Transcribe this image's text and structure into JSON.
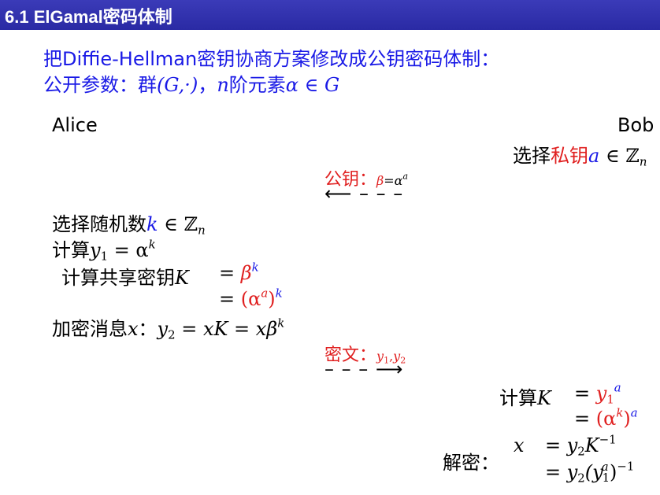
{
  "title": "6.1 ElGamal密码体制",
  "intro": {
    "line1": "把Diffie-Hellman密钥协商方案修改成公钥密码体制：",
    "line2_prefix": "公开参数：群",
    "line2_group": "(G,·)",
    "line2_sep": "，",
    "line2_n": "n",
    "line2_rest": "阶元素",
    "line2_expr": "α ∈ G"
  },
  "alice": "Alice",
  "bob": "Bob",
  "bob_key": {
    "prefix": "选择",
    "red": "私钥",
    "var": "a",
    "set": " ∈ ℤ",
    "sub": "n"
  },
  "pubkey_msg": {
    "label": "公钥：",
    "lhs": "β",
    "eq": "=",
    "base": "α",
    "exp": "a"
  },
  "arrow_left": "⟵ – – –",
  "alice_steps": {
    "choose_prefix": "选择随机数",
    "choose_var": "k",
    "choose_set": " ∈ ℤ",
    "choose_sub": "n",
    "calc_prefix": "计算",
    "calc_var": "y",
    "calc_sub": "1",
    "calc_eq": " = α",
    "calc_exp": "k",
    "shared_prefix": "计算共享密钥",
    "shared_var": "K",
    "shared_eq": "= ",
    "shared_base": "β",
    "shared_exp": "k",
    "shared2_eq": "= ",
    "shared2_open": "(α",
    "shared2_inner": "a",
    "shared2_close": ")",
    "shared2_exp": "k",
    "enc_prefix": "加密消息",
    "enc_var": "x",
    "enc_colon": "：",
    "enc_y": "y",
    "enc_sub": "2",
    "enc_rest": " = xK = xβ",
    "enc_exp": "k"
  },
  "cipher_msg": {
    "label": "密文：",
    "y1": "y",
    "s1": "1",
    "comma": ",",
    "y2": "y",
    "s2": "2"
  },
  "arrow_right": "– – – ⟶",
  "bob_steps": {
    "calc_prefix": "计算",
    "calc_var": "K",
    "eq1": "= ",
    "y1": "y",
    "y1_sub": "1",
    "y1_exp": "a",
    "eq2": "= ",
    "eq2_open": "(α",
    "eq2_inner": "k",
    "eq2_close": ")",
    "eq2_exp": "a",
    "dec_label": "解密：",
    "dec_var": "x",
    "dec_eq1": "= y",
    "dec_sub1": "2",
    "dec_k": "K",
    "dec_exp1": "−1",
    "dec_eq2": "= y",
    "dec_sub2": "2",
    "dec_open": "(y",
    "dec_in_sub": "1",
    "dec_in_exp": "a",
    "dec_close": ")",
    "dec_exp2": "−1"
  },
  "colors": {
    "title_bg": "#2a2aa4",
    "blue": "#1a1ae6",
    "red": "#e02020"
  }
}
